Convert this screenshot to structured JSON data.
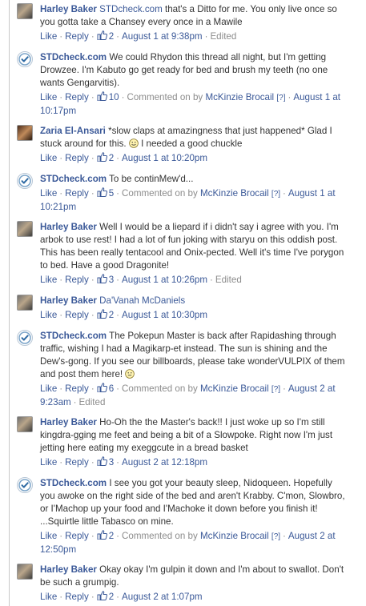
{
  "labels": {
    "like": "Like",
    "reply": "Reply",
    "sep": "·",
    "commented_on_by": "Commented on by",
    "help_marker": "[?]",
    "edited": "Edited"
  },
  "comments": [
    {
      "author": "Harley Baker",
      "mention": "STDcheck.com",
      "text": " that's a Ditto for me. You only live once so you gotta take a Chansey every once in a Mawile",
      "likes": "2",
      "time": "August 1 at 9:38pm",
      "edited": true,
      "commented_on": null,
      "avatar": "photo-icon"
    },
    {
      "author": "STDcheck.com",
      "mention": "",
      "text": " We could Rhydon this thread all night, but I'm getting Drowzee. I'm Kabuto go get ready for bed and brush my teeth (no one wants Gengarvitis).",
      "likes": "10",
      "time": "August 1 at 10:17pm",
      "edited": false,
      "commented_on": "McKinzie Brocail",
      "avatar": "checkmark-icon"
    },
    {
      "author": "Zaria El-Ansari",
      "mention": "",
      "text": " *slow claps at amazingness that just happened* Glad I stuck around for this.",
      "text2": " I needed a good chuckle",
      "likes": "2",
      "time": "August 1 at 10:20pm",
      "edited": false,
      "commented_on": null,
      "avatar": "photo-icon"
    },
    {
      "author": "STDcheck.com",
      "mention": "",
      "text": " To be continMew'd...",
      "likes": "5",
      "time": "August 1 at 10:21pm",
      "edited": false,
      "commented_on": "McKinzie Brocail",
      "avatar": "checkmark-icon"
    },
    {
      "author": "Harley Baker",
      "mention": "",
      "text": " Well I would be a liepard if i didn't say i agree with you. I'm arbok to use rest! I had a lot of fun joking with staryu on this oddish post. This has been really tentacool and Onix-pected. Well it's time I've porygon to bed. Have a good Dragonite!",
      "likes": "3",
      "time": "August 1 at 10:26pm",
      "edited": true,
      "commented_on": null,
      "avatar": "photo-icon"
    },
    {
      "author": "Harley Baker",
      "mention": "Da'Vanah McDaniels",
      "text": "",
      "likes": "2",
      "time": "August 1 at 10:30pm",
      "edited": false,
      "commented_on": null,
      "avatar": "photo-icon"
    },
    {
      "author": "STDcheck.com",
      "mention": "",
      "text": " The Pokepun Master is back after Rapidashing through traffic, wishing I had a Magikarp-et instead. The sun is shining and the Dew's-gong. If you see our billboards, please take wonderVULPIX of them and post them here!",
      "likes": "6",
      "time": "August 2 at 9:23am",
      "edited": true,
      "commented_on": "McKinzie Brocail",
      "avatar": "checkmark-icon"
    },
    {
      "author": "Harley Baker",
      "mention": "",
      "text": " Ho-Oh the the Master's back!! I just woke up so I'm still kingdra-gging me feet and being a bit of a Slowpoke. Right now I'm just jetting here eating my exeggcute in a bread basket",
      "likes": "3",
      "time": "August 2 at 12:18pm",
      "edited": false,
      "commented_on": null,
      "avatar": "photo-icon"
    },
    {
      "author": "STDcheck.com",
      "mention": "",
      "text": " I see you got your beauty sleep, Nidoqueen. Hopefully you awoke on the right side of the bed and aren't Krabby. C'mon, Slowbro, or I'Machop up your food and I'Machoke it down before you finish it! ...Squirtle little Tabasco on mine.",
      "likes": "2",
      "time": "August 2 at 12:50pm",
      "edited": false,
      "commented_on": "McKinzie Brocail",
      "avatar": "checkmark-icon"
    },
    {
      "author": "Harley Baker",
      "mention": "",
      "text": " Okay okay I'm gulpin it down and I'm about to swallot. Don't be such a grumpig.",
      "likes": "2",
      "time": "August 2 at 1:07pm",
      "edited": false,
      "commented_on": null,
      "avatar": "photo-icon"
    }
  ]
}
